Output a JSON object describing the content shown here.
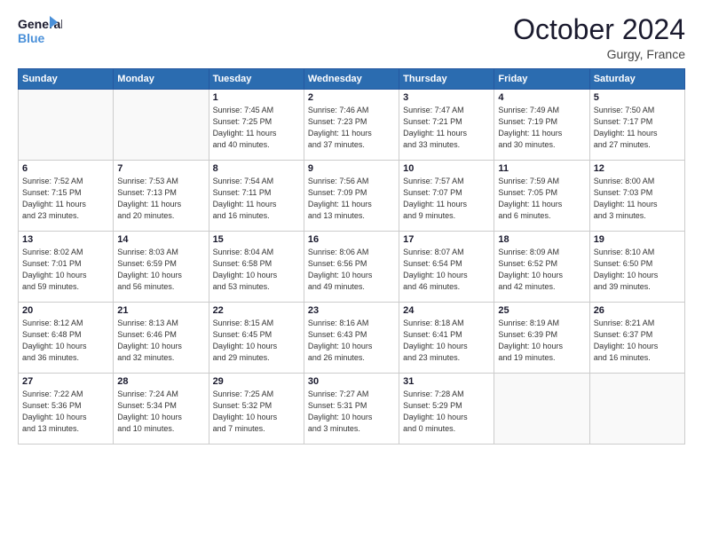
{
  "logo": {
    "line1": "General",
    "line2": "Blue"
  },
  "header": {
    "month": "October 2024",
    "location": "Gurgy, France"
  },
  "weekdays": [
    "Sunday",
    "Monday",
    "Tuesday",
    "Wednesday",
    "Thursday",
    "Friday",
    "Saturday"
  ],
  "weeks": [
    [
      {
        "day": "",
        "detail": ""
      },
      {
        "day": "",
        "detail": ""
      },
      {
        "day": "1",
        "detail": "Sunrise: 7:45 AM\nSunset: 7:25 PM\nDaylight: 11 hours\nand 40 minutes."
      },
      {
        "day": "2",
        "detail": "Sunrise: 7:46 AM\nSunset: 7:23 PM\nDaylight: 11 hours\nand 37 minutes."
      },
      {
        "day": "3",
        "detail": "Sunrise: 7:47 AM\nSunset: 7:21 PM\nDaylight: 11 hours\nand 33 minutes."
      },
      {
        "day": "4",
        "detail": "Sunrise: 7:49 AM\nSunset: 7:19 PM\nDaylight: 11 hours\nand 30 minutes."
      },
      {
        "day": "5",
        "detail": "Sunrise: 7:50 AM\nSunset: 7:17 PM\nDaylight: 11 hours\nand 27 minutes."
      }
    ],
    [
      {
        "day": "6",
        "detail": "Sunrise: 7:52 AM\nSunset: 7:15 PM\nDaylight: 11 hours\nand 23 minutes."
      },
      {
        "day": "7",
        "detail": "Sunrise: 7:53 AM\nSunset: 7:13 PM\nDaylight: 11 hours\nand 20 minutes."
      },
      {
        "day": "8",
        "detail": "Sunrise: 7:54 AM\nSunset: 7:11 PM\nDaylight: 11 hours\nand 16 minutes."
      },
      {
        "day": "9",
        "detail": "Sunrise: 7:56 AM\nSunset: 7:09 PM\nDaylight: 11 hours\nand 13 minutes."
      },
      {
        "day": "10",
        "detail": "Sunrise: 7:57 AM\nSunset: 7:07 PM\nDaylight: 11 hours\nand 9 minutes."
      },
      {
        "day": "11",
        "detail": "Sunrise: 7:59 AM\nSunset: 7:05 PM\nDaylight: 11 hours\nand 6 minutes."
      },
      {
        "day": "12",
        "detail": "Sunrise: 8:00 AM\nSunset: 7:03 PM\nDaylight: 11 hours\nand 3 minutes."
      }
    ],
    [
      {
        "day": "13",
        "detail": "Sunrise: 8:02 AM\nSunset: 7:01 PM\nDaylight: 10 hours\nand 59 minutes."
      },
      {
        "day": "14",
        "detail": "Sunrise: 8:03 AM\nSunset: 6:59 PM\nDaylight: 10 hours\nand 56 minutes."
      },
      {
        "day": "15",
        "detail": "Sunrise: 8:04 AM\nSunset: 6:58 PM\nDaylight: 10 hours\nand 53 minutes."
      },
      {
        "day": "16",
        "detail": "Sunrise: 8:06 AM\nSunset: 6:56 PM\nDaylight: 10 hours\nand 49 minutes."
      },
      {
        "day": "17",
        "detail": "Sunrise: 8:07 AM\nSunset: 6:54 PM\nDaylight: 10 hours\nand 46 minutes."
      },
      {
        "day": "18",
        "detail": "Sunrise: 8:09 AM\nSunset: 6:52 PM\nDaylight: 10 hours\nand 42 minutes."
      },
      {
        "day": "19",
        "detail": "Sunrise: 8:10 AM\nSunset: 6:50 PM\nDaylight: 10 hours\nand 39 minutes."
      }
    ],
    [
      {
        "day": "20",
        "detail": "Sunrise: 8:12 AM\nSunset: 6:48 PM\nDaylight: 10 hours\nand 36 minutes."
      },
      {
        "day": "21",
        "detail": "Sunrise: 8:13 AM\nSunset: 6:46 PM\nDaylight: 10 hours\nand 32 minutes."
      },
      {
        "day": "22",
        "detail": "Sunrise: 8:15 AM\nSunset: 6:45 PM\nDaylight: 10 hours\nand 29 minutes."
      },
      {
        "day": "23",
        "detail": "Sunrise: 8:16 AM\nSunset: 6:43 PM\nDaylight: 10 hours\nand 26 minutes."
      },
      {
        "day": "24",
        "detail": "Sunrise: 8:18 AM\nSunset: 6:41 PM\nDaylight: 10 hours\nand 23 minutes."
      },
      {
        "day": "25",
        "detail": "Sunrise: 8:19 AM\nSunset: 6:39 PM\nDaylight: 10 hours\nand 19 minutes."
      },
      {
        "day": "26",
        "detail": "Sunrise: 8:21 AM\nSunset: 6:37 PM\nDaylight: 10 hours\nand 16 minutes."
      }
    ],
    [
      {
        "day": "27",
        "detail": "Sunrise: 7:22 AM\nSunset: 5:36 PM\nDaylight: 10 hours\nand 13 minutes."
      },
      {
        "day": "28",
        "detail": "Sunrise: 7:24 AM\nSunset: 5:34 PM\nDaylight: 10 hours\nand 10 minutes."
      },
      {
        "day": "29",
        "detail": "Sunrise: 7:25 AM\nSunset: 5:32 PM\nDaylight: 10 hours\nand 7 minutes."
      },
      {
        "day": "30",
        "detail": "Sunrise: 7:27 AM\nSunset: 5:31 PM\nDaylight: 10 hours\nand 3 minutes."
      },
      {
        "day": "31",
        "detail": "Sunrise: 7:28 AM\nSunset: 5:29 PM\nDaylight: 10 hours\nand 0 minutes."
      },
      {
        "day": "",
        "detail": ""
      },
      {
        "day": "",
        "detail": ""
      }
    ]
  ]
}
